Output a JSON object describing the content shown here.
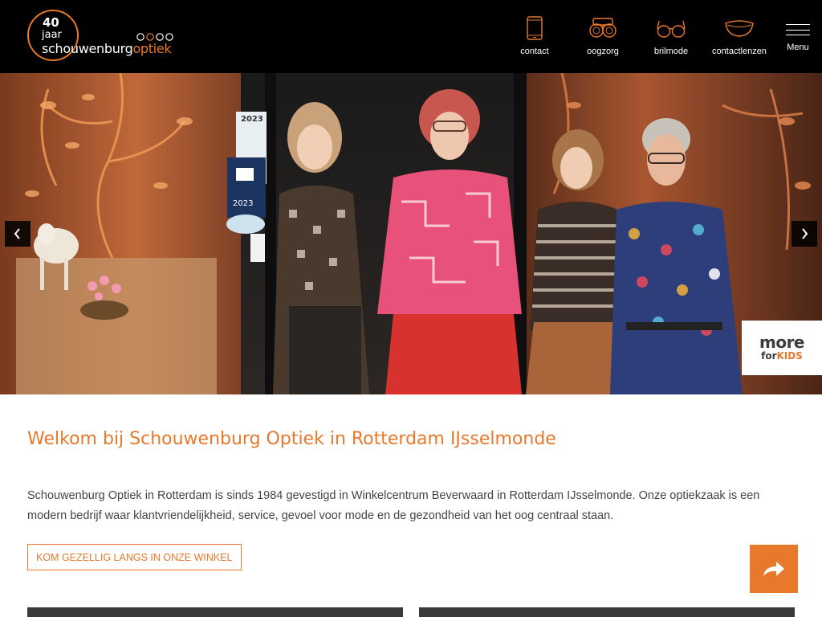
{
  "brand": {
    "anniversary_number": "40",
    "anniversary_word": "jaar",
    "name_part1": "schouwenburg",
    "name_part2": "optiek",
    "accent_color": "#e8782a",
    "logo_icon": "logo-circle-rings"
  },
  "nav": {
    "items": [
      {
        "label": "contact",
        "icon": "phone-icon"
      },
      {
        "label": "oogzorg",
        "icon": "binocular-icon"
      },
      {
        "label": "brilmode",
        "icon": "glasses-icon"
      },
      {
        "label": "contactlenzen",
        "icon": "lens-icon"
      }
    ],
    "menu_label": "Menu",
    "menu_icon": "hamburger-icon"
  },
  "hero": {
    "prev_icon": "chevron-left-icon",
    "next_icon": "chevron-right-icon",
    "kids_badge": {
      "word": "more",
      "for_text": "for",
      "kids_text": "KIDS"
    },
    "sign_year_top": "2023",
    "sign_year_bottom": "2023"
  },
  "main": {
    "title": "Welkom bij Schouwenburg Optiek in Rotterdam IJsselmonde",
    "intro": "Schouwenburg Optiek in Rotterdam is sinds 1984 gevestigd in Winkelcentrum Beverwaard in Rotterdam IJsselmonde. Onze optiekzaak is een modern bedrijf waar klantvriendelijkheid, service, gevoel voor mode en de gezondheid van het oog centraal staan.",
    "cta_label": "KOM GEZELLIG LANGS IN ONZE WINKEL",
    "share_icon": "share-arrow-icon"
  }
}
